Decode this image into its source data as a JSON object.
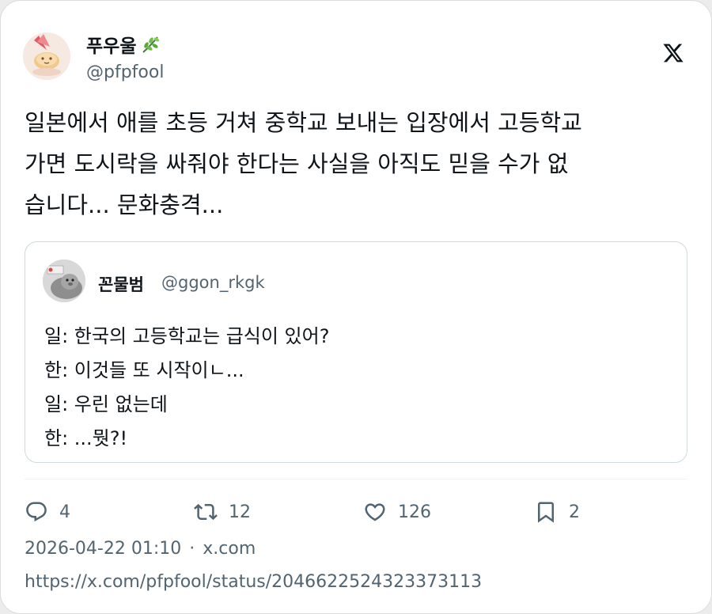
{
  "author": {
    "display_name": "푸우울",
    "handle": "@pfpfool",
    "name_emoji": "herb-emoji"
  },
  "tweet": {
    "lines": [
      "일본에서 애를 초등 거쳐 중학교 보내는 입장에서 고등학교",
      "가면 도시락을 싸줘야 한다는 사실을 아직도 믿을 수가 없",
      "습니다... 문화충격..."
    ]
  },
  "quote": {
    "display_name": "꼰물범",
    "handle": "@ggon_rkgk",
    "lines": [
      "일: 한국의 고등학교는 급식이 있어?",
      "한: 이것들 또 시작이ㄴ...",
      "일: 우린 없는데",
      "한: ...뭣?!"
    ]
  },
  "actions": {
    "reply_count": "4",
    "retweet_count": "12",
    "like_count": "126",
    "bookmark_count": "2"
  },
  "meta": {
    "timestamp": "2026-04-22 01:10",
    "separator": "·",
    "source": "x.com",
    "url": "https://x.com/pfpfool/status/2046622524323373113"
  },
  "icons": {
    "platform_logo": "x-logo-icon",
    "reply": "reply-icon",
    "retweet": "retweet-icon",
    "like": "heart-icon",
    "bookmark": "bookmark-icon"
  },
  "colors": {
    "text_primary": "#0f1419",
    "text_secondary": "#536471",
    "border": "#cfd9de",
    "background": "#ffffff"
  }
}
